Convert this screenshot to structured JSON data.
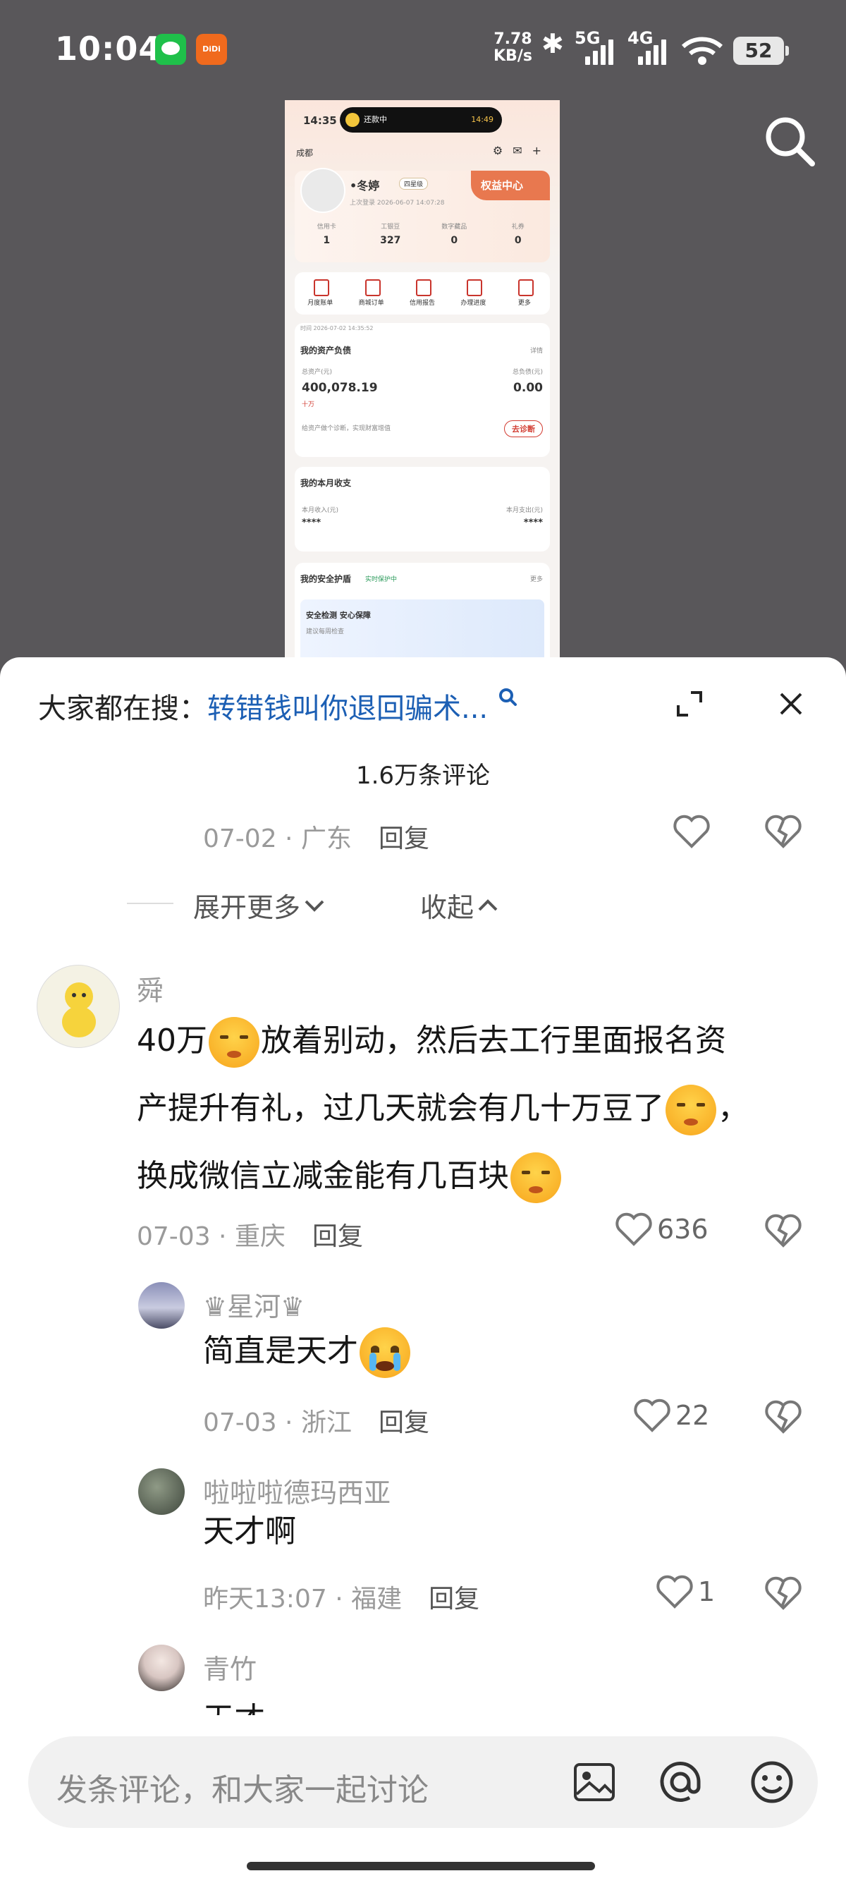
{
  "status_bar": {
    "time": "10:04",
    "net_speed_value": "7.78",
    "net_speed_unit": "KB/s",
    "sim1": "5G",
    "sim2": "4G",
    "battery": "52"
  },
  "thumbnail": {
    "time": "14:35",
    "island_left": "还款中",
    "island_right": "14:49",
    "city": "成都",
    "user_name": "•冬婷",
    "user_tag": "四星级",
    "last_login": "上次登录 2026-06-07 14:07:28",
    "vip_label": "权益中心",
    "stats": [
      {
        "label": "信用卡",
        "value": "1"
      },
      {
        "label": "工银豆",
        "value": "327"
      },
      {
        "label": "数字藏品",
        "value": "0"
      },
      {
        "label": "礼券",
        "value": "0"
      }
    ],
    "menu": [
      "月度账单",
      "商城订单",
      "信用报告",
      "办理进度",
      "更多"
    ],
    "timestamp": "时间 2026-07-02 14:35:52",
    "asset_title": "我的资产负债",
    "asset_detail": "详情",
    "total_assets_label": "总资产(元)",
    "total_assets_value": "400,078.19",
    "total_assets_hint": "十万",
    "total_debt_label": "总负债(元)",
    "total_debt_value": "0.00",
    "diagnose_tip": "给资产做个诊断，实现财富增值",
    "diagnose_button": "去诊断",
    "income_title": "我的本月收支",
    "income_label": "本月收入(元)",
    "income_value": "****",
    "expense_label": "本月支出(元)",
    "expense_value": "****",
    "safe_title": "我的安全护盾",
    "safe_status": "实时保护中",
    "safe_more": "更多",
    "safe_box_title": "安全检测 安心保障",
    "safe_box_sub": "建议每周检查"
  },
  "sheet": {
    "hot_prefix": "大家都在搜：",
    "hot_query": "转错钱叫你退回骗术...",
    "comment_count": "1.6万条评论",
    "prev_meta": {
      "date": "07-02",
      "region": "广东",
      "reply": "回复"
    },
    "expand_more": "展开更多",
    "collapse": "收起",
    "comments": [
      {
        "user": "舜",
        "lines": [
          "40万",
          "放着别动，然后去工行里面报名资",
          "产提升有礼，过几天就会有几十万豆了",
          "，",
          "换成微信立减金能有几百块"
        ],
        "date": "07-03",
        "region": "重庆",
        "reply": "回复",
        "likes": "636"
      },
      {
        "user": "♛星河♛",
        "text": "简直是天才",
        "date": "07-03",
        "region": "浙江",
        "reply": "回复",
        "likes": "22"
      },
      {
        "user": "啦啦啦德玛西亚",
        "text": "天才啊",
        "date": "昨天13:07",
        "region": "福建",
        "reply": "回复",
        "likes": "1"
      },
      {
        "user": "青竹",
        "text": "天才"
      }
    ],
    "input_placeholder": "发条评论，和大家一起讨论"
  },
  "icons": [
    "search-icon",
    "expand-icon",
    "close-icon",
    "heart-icon",
    "broken-heart-icon",
    "image-icon",
    "at-icon",
    "emoji-icon",
    "chevron-down-icon",
    "chevron-up-icon"
  ],
  "colors": {
    "link": "#1c5fb4",
    "brand_red": "#d23b30",
    "overlay": "#59575a"
  }
}
